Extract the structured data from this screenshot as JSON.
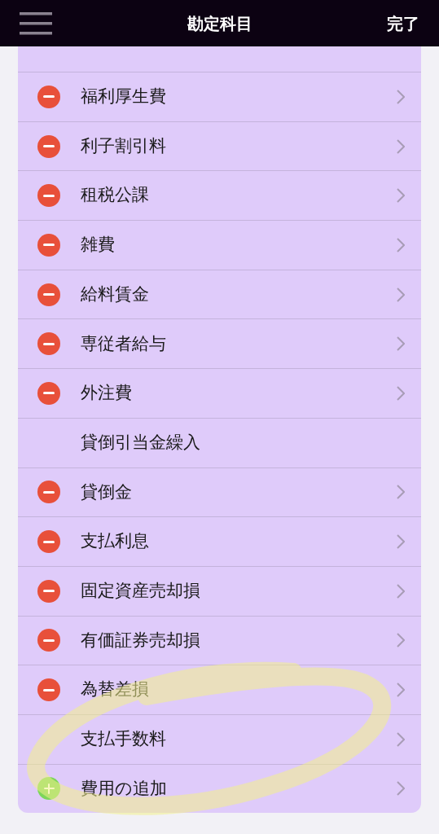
{
  "header": {
    "title": "勘定科目",
    "done": "完了"
  },
  "rows": [
    {
      "label": "福利厚生費",
      "kind": "delete",
      "chevron": true
    },
    {
      "label": "利子割引料",
      "kind": "delete",
      "chevron": true
    },
    {
      "label": "租税公課",
      "kind": "delete",
      "chevron": true
    },
    {
      "label": "雑費",
      "kind": "delete",
      "chevron": true
    },
    {
      "label": "給料賃金",
      "kind": "delete",
      "chevron": true
    },
    {
      "label": "専従者給与",
      "kind": "delete",
      "chevron": true
    },
    {
      "label": "外注費",
      "kind": "delete",
      "chevron": true
    },
    {
      "label": "貸倒引当金繰入",
      "kind": "none",
      "chevron": false
    },
    {
      "label": "貸倒金",
      "kind": "delete",
      "chevron": true
    },
    {
      "label": "支払利息",
      "kind": "delete",
      "chevron": true
    },
    {
      "label": "固定資産売却損",
      "kind": "delete",
      "chevron": true
    },
    {
      "label": "有価証券売却損",
      "kind": "delete",
      "chevron": true
    },
    {
      "label": "為替差損",
      "kind": "delete",
      "chevron": true
    },
    {
      "label": "支払手数料",
      "kind": "none",
      "chevron": true
    },
    {
      "label": "費用の追加",
      "kind": "add",
      "chevron": true
    }
  ]
}
